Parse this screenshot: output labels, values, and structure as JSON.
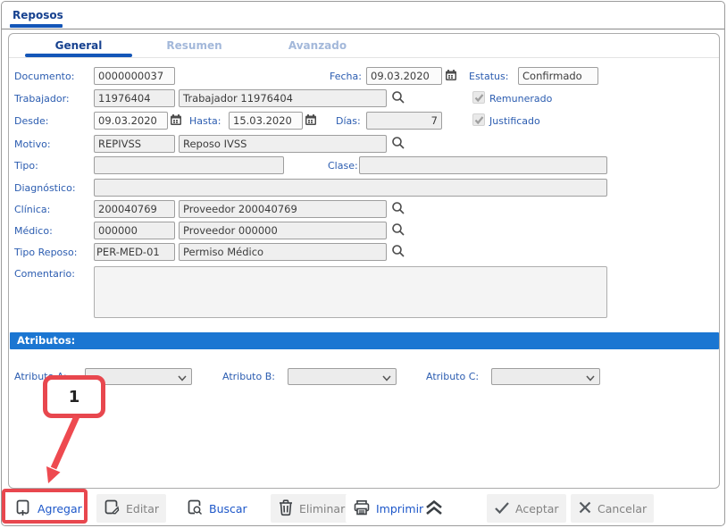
{
  "window": {
    "title": "Reposos"
  },
  "tabs": {
    "general": "General",
    "resumen": "Resumen",
    "avanzado": "Avanzado"
  },
  "form": {
    "documento": {
      "label": "Documento:",
      "value": "0000000037"
    },
    "fecha": {
      "label": "Fecha:",
      "value": "09.03.2020"
    },
    "estatus": {
      "label": "Estatus:",
      "value": "Confirmado"
    },
    "trabajador": {
      "label": "Trabajador:",
      "code": "11976404",
      "name": "Trabajador 11976404"
    },
    "remunerado": {
      "label": "Remunerado",
      "checked": "true"
    },
    "desde": {
      "label": "Desde:",
      "value": "09.03.2020"
    },
    "hasta": {
      "label": "Hasta:",
      "value": "15.03.2020"
    },
    "dias": {
      "label": "Días:",
      "value": "7"
    },
    "justificado": {
      "label": "Justificado",
      "checked": "true"
    },
    "motivo": {
      "label": "Motivo:",
      "code": "REPIVSS",
      "name": "Reposo IVSS"
    },
    "tipo": {
      "label": "Tipo:",
      "value": ""
    },
    "clase": {
      "label": "Clase:",
      "value": ""
    },
    "diagnostico": {
      "label": "Diagnóstico:",
      "value": ""
    },
    "clinica": {
      "label": "Clínica:",
      "code": "200040769",
      "name": "Proveedor 200040769"
    },
    "medico": {
      "label": "Médico:",
      "code": "000000",
      "name": "Proveedor 000000"
    },
    "tipo_reposo": {
      "label": "Tipo Reposo:",
      "code": "PER-MED-01",
      "name": "Permiso Médico"
    },
    "comentario": {
      "label": "Comentario:",
      "value": ""
    }
  },
  "atributos": {
    "header": "Atributos:",
    "a": {
      "label": "Atributo A:",
      "value": ""
    },
    "b": {
      "label": "Atributo B:",
      "value": ""
    },
    "c": {
      "label": "Atributo C:",
      "value": ""
    }
  },
  "annotation": {
    "step": "1"
  },
  "toolbar": {
    "agregar": "Agregar",
    "editar": "Editar",
    "buscar": "Buscar",
    "eliminar": "Eliminar",
    "imprimir": "Imprimir",
    "aceptar": "Aceptar",
    "cancelar": "Cancelar"
  },
  "colors": {
    "accent_blue": "#1456b8",
    "label_blue": "#2b5cb0",
    "attr_bar_blue": "#1b76d2",
    "toolbar_link_blue": "#1d57c9",
    "annotation_red": "#e8474e",
    "inactive_tab": "#a3b8da"
  }
}
